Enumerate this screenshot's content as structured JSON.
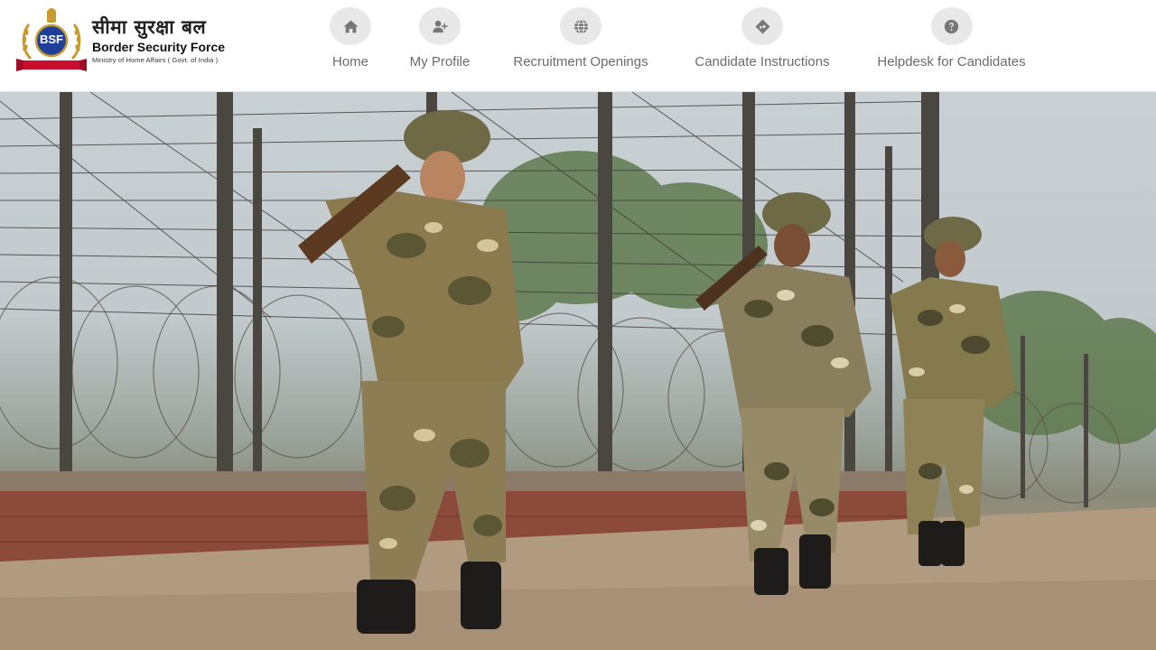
{
  "brand": {
    "badge_text": "BSF",
    "hindi_name": "सीमा सुरक्षा बल",
    "english_name": "Border Security Force",
    "ministry": "Ministry of Home Affairs ( Govt. of India )"
  },
  "nav": {
    "items": [
      {
        "label": "Home",
        "icon": "home-icon"
      },
      {
        "label": "My Profile",
        "icon": "user-plus-icon"
      },
      {
        "label": "Recruitment Openings",
        "icon": "globe-icon"
      },
      {
        "label": "Candidate Instructions",
        "icon": "directions-icon"
      },
      {
        "label": "Helpdesk for Candidates",
        "icon": "question-icon"
      }
    ]
  },
  "hero": {
    "description": "banner-photo"
  },
  "colors": {
    "nav_text": "#6b6b6b",
    "icon_bg": "#e8e8e8",
    "brand_red": "#c8102e",
    "brand_blue": "#1f3f9a",
    "brand_gold": "#c99a2e"
  }
}
